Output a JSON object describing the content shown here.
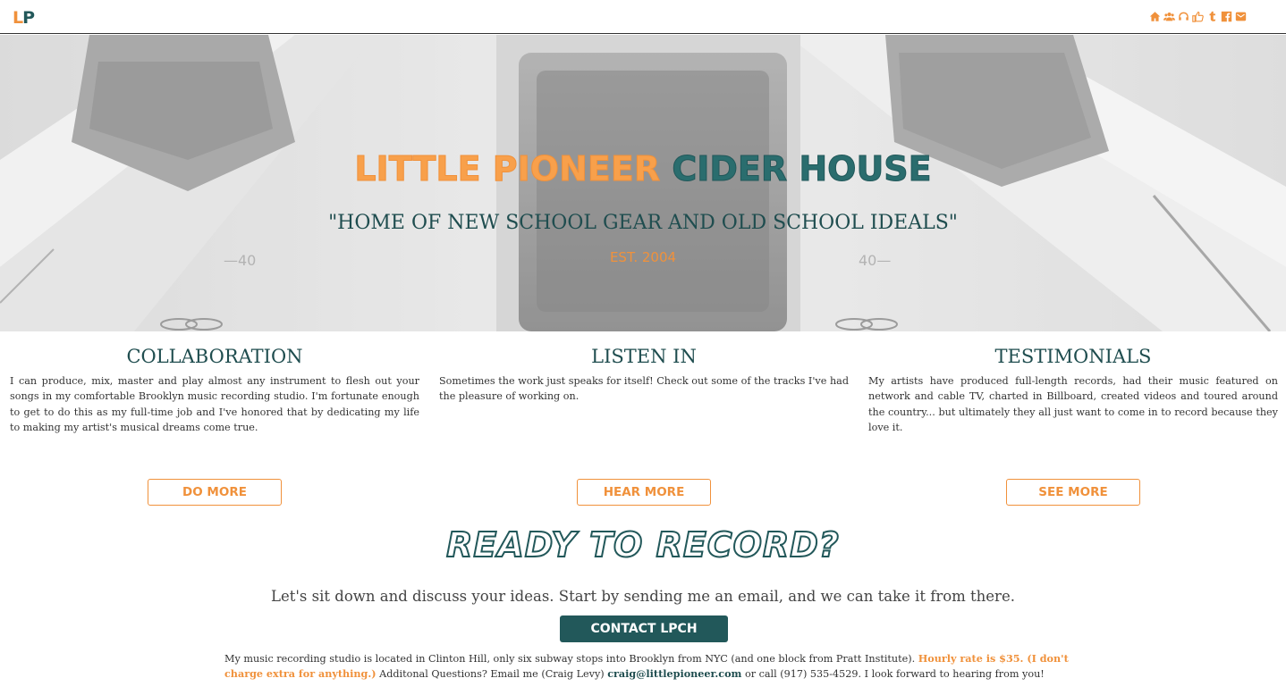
{
  "nav": {
    "logo_l": "L",
    "logo_p": "P",
    "icons": [
      "home-icon",
      "users-icon",
      "headphones-icon",
      "thumbs-up-icon",
      "tumblr-icon",
      "facebook-icon",
      "envelope-icon"
    ]
  },
  "hero": {
    "title_part1": "LITTLE PIONEER",
    "title_part2": "CIDER HOUSE",
    "subtitle": "\"HOME OF NEW SCHOOL GEAR AND OLD SCHOOL IDEALS\"",
    "est": "EST. 2004"
  },
  "features": [
    {
      "title": "COLLABORATION",
      "text": "I can produce, mix, master and play almost any instrument to flesh out your songs in my comfortable Brooklyn music recording studio. I'm fortunate enough to get to do this as my full-time job and I've honored that by dedicating my life to making my artist's musical dreams come true.",
      "button": "DO MORE"
    },
    {
      "title": "LISTEN IN",
      "text": "Sometimes the work just speaks for itself! Check out some of the tracks I've had the pleasure of working on.",
      "button": "HEAR MORE"
    },
    {
      "title": "TESTIMONIALS",
      "text": "My artists have produced full-length records, had their music featured on network and cable TV, charted in Billboard, created videos and toured around the country... but ultimately they all just want to come in to record because they love it.",
      "button": "SEE MORE"
    }
  ],
  "ready": {
    "title": "READY TO RECORD?",
    "subtitle": "Let's sit down and discuss your ideas. Start by sending me an email, and we can take it from there.",
    "button": "CONTACT LPCH"
  },
  "footer": {
    "text1": "My music recording studio is located in Clinton Hill, only six subway stops into Brooklyn from NYC (and one block from Pratt Institute).",
    "highlight": "Hourly rate is $35. (I don't charge extra for anything.)",
    "text2": "Additonal Questions? Email me (Craig Levy)",
    "email": "craig@littlepioneer.com",
    "text3": "or call (917) 535-4529. I look forward to hearing from you!"
  },
  "colors": {
    "orange": "#f0913b",
    "teal": "#22585a"
  }
}
